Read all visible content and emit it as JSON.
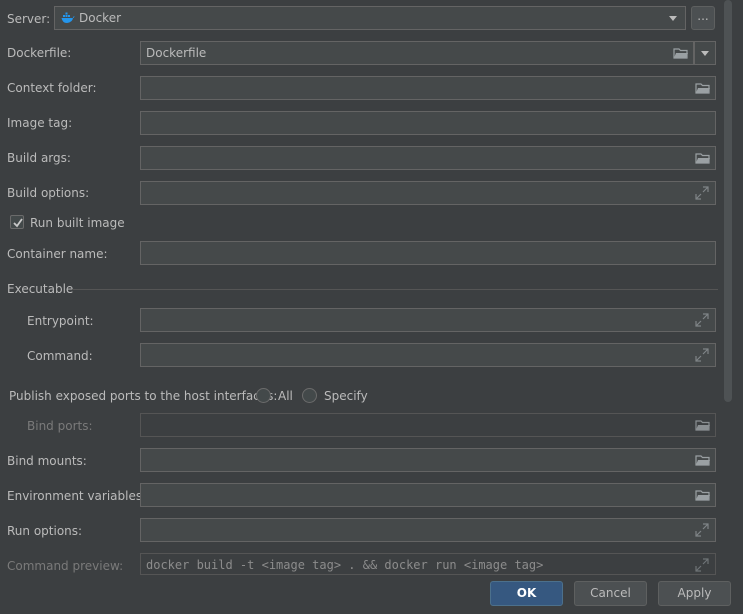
{
  "server": {
    "label": "Server:",
    "value": "Docker",
    "icon": "docker-icon",
    "more_label": "..."
  },
  "dockerfile": {
    "label": "Dockerfile:",
    "value": "Dockerfile"
  },
  "context_folder": {
    "label": "Context folder:",
    "value": ""
  },
  "image_tag": {
    "label": "Image tag:",
    "value": ""
  },
  "build_args": {
    "label": "Build args:",
    "value": ""
  },
  "build_options": {
    "label": "Build options:",
    "value": ""
  },
  "run_built_image": {
    "label": "Run built image",
    "checked": true
  },
  "container_name": {
    "label": "Container name:",
    "value": ""
  },
  "executable": {
    "section_title": "Executable",
    "entrypoint": {
      "label": "Entrypoint:",
      "value": ""
    },
    "command": {
      "label": "Command:",
      "value": ""
    }
  },
  "publish_ports": {
    "label": "Publish exposed ports to the host interfaces:",
    "options": [
      "All",
      "Specify"
    ]
  },
  "bind_ports": {
    "label": "Bind ports:",
    "value": ""
  },
  "bind_mounts": {
    "label": "Bind mounts:",
    "value": ""
  },
  "env_vars": {
    "label": "Environment variables:",
    "value": ""
  },
  "run_options": {
    "label": "Run options:",
    "value": ""
  },
  "command_preview": {
    "label": "Command preview:",
    "value": "docker build -t <image tag> . && docker run <image tag>"
  },
  "footer": {
    "ok": "OK",
    "cancel": "Cancel",
    "apply": "Apply"
  },
  "colors": {
    "background": "#3c3f41",
    "primary_button": "#365880",
    "docker_blue": "#2496ed"
  }
}
